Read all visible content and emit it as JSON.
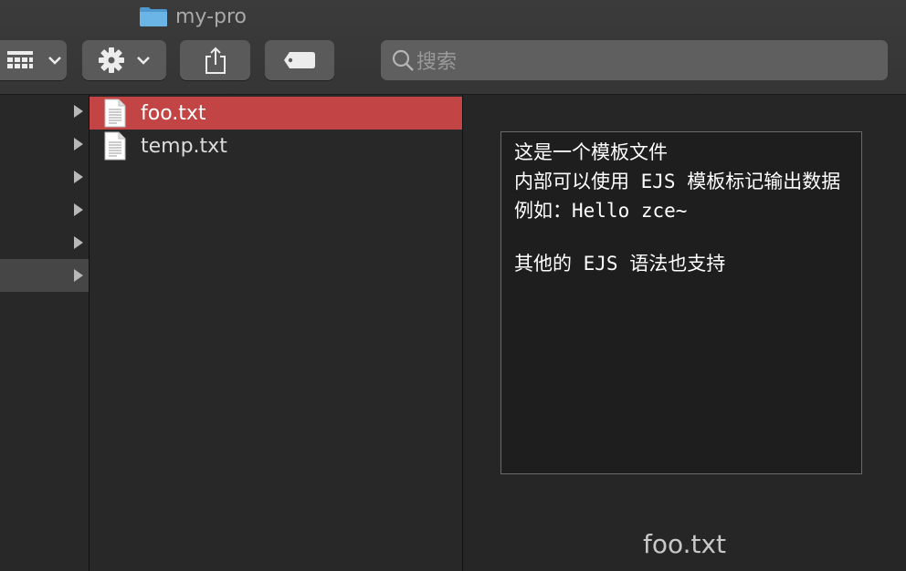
{
  "window": {
    "title": "my-pro"
  },
  "toolbar": {
    "search_placeholder": "搜索"
  },
  "sidebar": {
    "rows": [
      {
        "expanded": false
      },
      {
        "expanded": false
      },
      {
        "expanded": false
      },
      {
        "expanded": false
      },
      {
        "expanded": false
      },
      {
        "expanded": false,
        "selected": true
      }
    ]
  },
  "files": [
    {
      "name": "foo.txt",
      "selected": true
    },
    {
      "name": "temp.txt",
      "selected": false
    }
  ],
  "preview": {
    "lines": [
      "这是一个模板文件",
      "内部可以使用 EJS 模板标记输出数据",
      "例如：Hello zce~",
      "",
      "其他的 EJS 语法也支持"
    ],
    "filename": "foo.txt"
  },
  "colors": {
    "selection": "#c24444",
    "folder": "#5ea8dc"
  }
}
